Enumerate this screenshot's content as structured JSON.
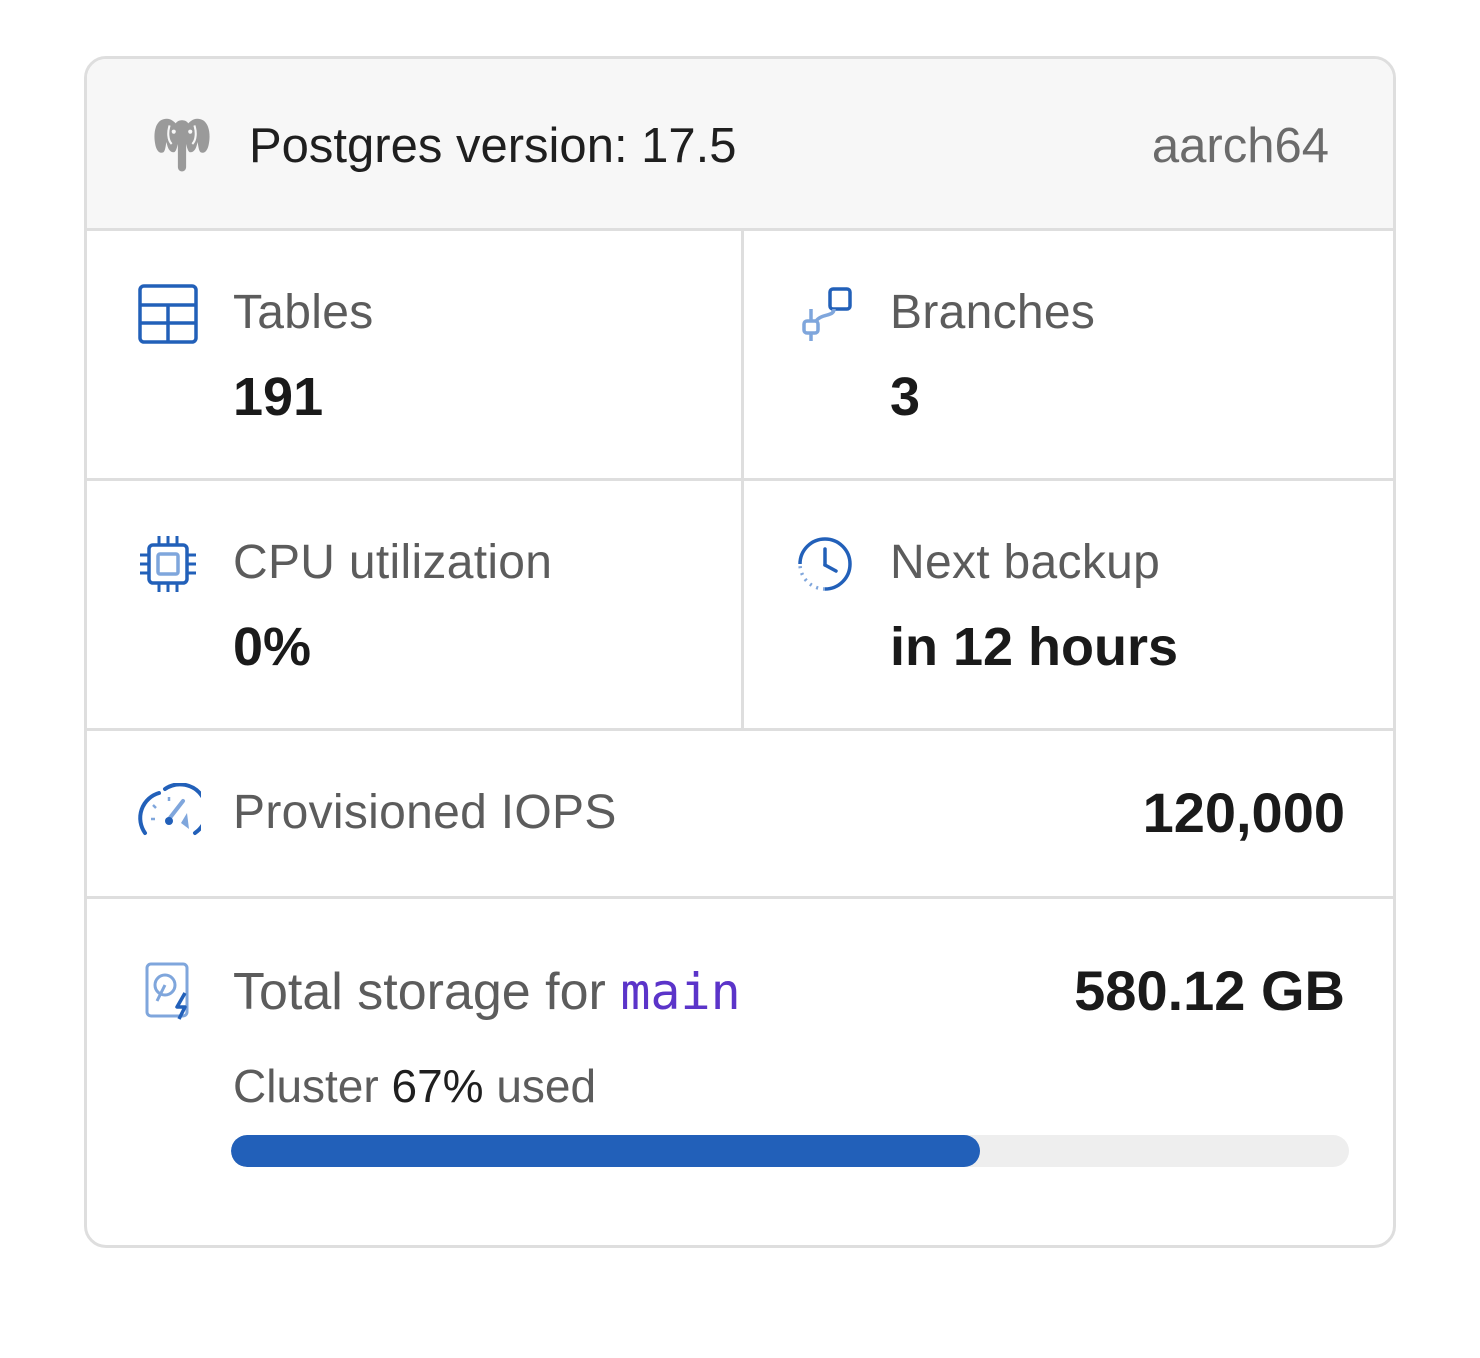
{
  "header": {
    "icon": "postgres-elephant-icon",
    "version_label": "Postgres version: 17.5",
    "architecture": "aarch64"
  },
  "stats": {
    "tables": {
      "icon": "table-icon",
      "label": "Tables",
      "value": "191"
    },
    "branches": {
      "icon": "branch-icon",
      "label": "Branches",
      "value": "3"
    },
    "cpu": {
      "icon": "cpu-chip-icon",
      "label": "CPU utilization",
      "value": "0%"
    },
    "backup": {
      "icon": "clock-icon",
      "label": "Next backup",
      "value": "in 12 hours"
    }
  },
  "iops": {
    "icon": "gauge-icon",
    "label": "Provisioned IOPS",
    "value": "120,000"
  },
  "storage": {
    "icon": "storage-disk-icon",
    "label_prefix": "Total storage for ",
    "branch_name": "main",
    "value": "580.12 GB",
    "usage_prefix": "Cluster ",
    "usage_percent_text": "67%",
    "usage_suffix": " used",
    "usage_fraction": 0.67
  },
  "colors": {
    "accent_blue": "#2260b9",
    "branch_purple": "#5b34c9",
    "border": "#dedede",
    "muted_text": "#5c5c5c"
  }
}
